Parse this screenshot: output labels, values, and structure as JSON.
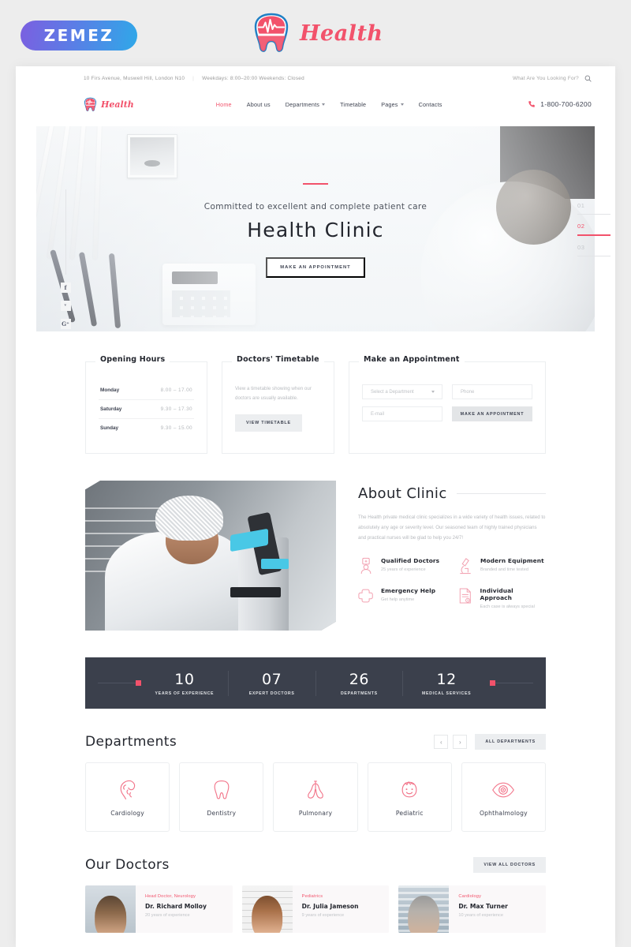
{
  "preview": {
    "badge_label": "ZEMEZ",
    "brand_name": "Health"
  },
  "topbar": {
    "address": "10 Firs Avenue, Muswell Hill, London N10",
    "hours": "Weekdays: 8:00–20:00 Weekends: Closed",
    "search_placeholder": "What Are You Looking For?"
  },
  "header": {
    "logo_text": "Health",
    "phone": "1-800-700-6200",
    "nav": [
      {
        "label": "Home",
        "active": true,
        "caret": false
      },
      {
        "label": "About us",
        "active": false,
        "caret": false
      },
      {
        "label": "Departments",
        "active": false,
        "caret": true
      },
      {
        "label": "Timetable",
        "active": false,
        "caret": false
      },
      {
        "label": "Pages",
        "active": false,
        "caret": true
      },
      {
        "label": "Contacts",
        "active": false,
        "caret": false
      }
    ]
  },
  "social": [
    {
      "label": "f",
      "name": "facebook"
    },
    {
      "label": "ᵛ",
      "name": "twitter"
    },
    {
      "label": "G⁺",
      "name": "google-plus"
    }
  ],
  "hero": {
    "subtitle": "Committed to excellent and complete patient care",
    "title": "Health Clinic",
    "button": "MAKE AN APPOINTMENT",
    "slides": [
      {
        "num": "01",
        "active": false
      },
      {
        "num": "02",
        "active": true
      },
      {
        "num": "03",
        "active": false
      }
    ]
  },
  "opening_hours": {
    "title": "Opening Hours",
    "rows": [
      {
        "day": "Monday",
        "time": "8.00 – 17.00"
      },
      {
        "day": "Saturday",
        "time": "9.30 – 17.30"
      },
      {
        "day": "Sunday",
        "time": "9.30 – 15.00"
      }
    ]
  },
  "timetable": {
    "title": "Doctors' Timetable",
    "text": "View a timetable showing when our doctors are usually available.",
    "button": "VIEW TIMETABLE"
  },
  "appointment": {
    "title": "Make an Appointment",
    "department_placeholder": "Select a Department",
    "phone_placeholder": "Phone",
    "email_placeholder": "E-mail",
    "button": "MAKE AN APPOINTMENT"
  },
  "about": {
    "title": "About Clinic",
    "text": "The Health private medical clinic specializes in a wide variety of health issues, related to absolutely any age or severity level. Our seasoned team of highly trained physicians and practical nurses will be glad to help you 24/7!",
    "features": [
      {
        "icon": "doctor-icon",
        "title": "Qualified Doctors",
        "sub": "25 years of experience"
      },
      {
        "icon": "microscope-icon",
        "title": "Modern Equipment",
        "sub": "Branded and time tested"
      },
      {
        "icon": "cross-icon",
        "title": "Emergency Help",
        "sub": "Get help anytime"
      },
      {
        "icon": "document-icon",
        "title": "Individual Approach",
        "sub": "Each case is always special"
      }
    ]
  },
  "stats": [
    {
      "num": "10",
      "label": "YEARS OF EXPERIENCE"
    },
    {
      "num": "07",
      "label": "EXPERT DOCTORS"
    },
    {
      "num": "26",
      "label": "DEPARTMENTS"
    },
    {
      "num": "12",
      "label": "MEDICAL SERVICES"
    }
  ],
  "departments": {
    "title": "Departments",
    "prev": "‹",
    "next": "›",
    "all_button": "ALL DEPARTMENTS",
    "items": [
      {
        "name": "Cardiology",
        "icon": "heart-icon"
      },
      {
        "name": "Dentistry",
        "icon": "tooth-icon"
      },
      {
        "name": "Pulmonary",
        "icon": "lungs-icon"
      },
      {
        "name": "Pediatric",
        "icon": "child-face-icon"
      },
      {
        "name": "Ophthalmology",
        "icon": "eye-icon"
      }
    ]
  },
  "doctors": {
    "title": "Our Doctors",
    "all_button": "VIEW ALL DOCTORS",
    "items": [
      {
        "spec": "Head Doctor, Neurology",
        "name": "Dr. Richard Molloy",
        "exp": "20 years of experience"
      },
      {
        "spec": "Pediatrics",
        "name": "Dr. Julia Jameson",
        "exp": "9 years of experience"
      },
      {
        "spec": "Cardiology",
        "name": "Dr. Max Turner",
        "exp": "10 years of experience"
      }
    ]
  },
  "colors": {
    "accent": "#f2526b",
    "dark": "#3b404c",
    "text": "#23262e",
    "muted": "#b7babe"
  }
}
